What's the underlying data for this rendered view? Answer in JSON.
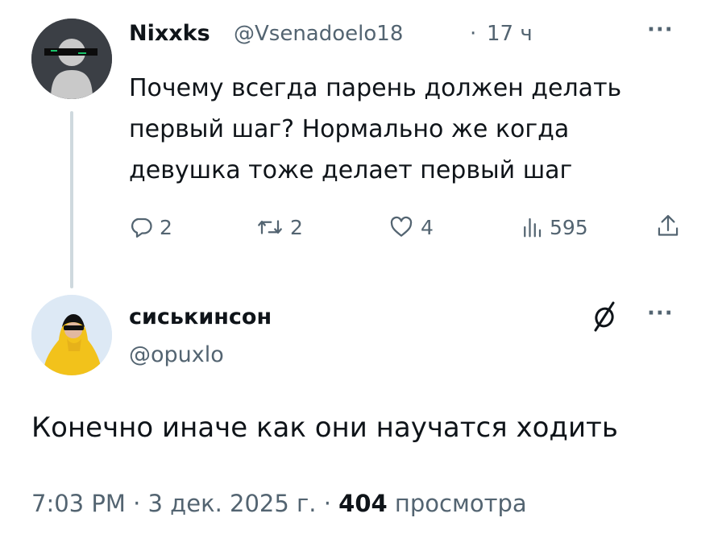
{
  "tweet1": {
    "display_name": "Nixxks",
    "handle": "@Vsenadoelo18",
    "separator": "·",
    "time": "17 ч",
    "more_label": "···",
    "text": "Почему всегда парень должен делать\nпервый шаг? Нормально же когда\nдевушка тоже делает первый шаг",
    "actions": {
      "reply_count": "2",
      "retweet_count": "2",
      "like_count": "4",
      "view_count": "595"
    }
  },
  "tweet2": {
    "display_name": "сиськинсон",
    "handle": "@opuxlo",
    "more_label": "···",
    "text": "Конечно иначе как они научатся ходить",
    "meta": {
      "time": "7:03 PM",
      "sep1": " · ",
      "date": "3 дек. 2025 г.",
      "sep2": " · ",
      "views_count": "404",
      "views_label": " просмотра"
    }
  },
  "icons": [
    "reply-icon",
    "retweet-icon",
    "like-icon",
    "views-icon",
    "share-icon",
    "badge-icon",
    "more-icon"
  ],
  "colors": {
    "text_primary": "#0f1419",
    "text_secondary": "#536471",
    "thread_line": "#cfd9de",
    "avatar2_hood": "#f2c21b"
  }
}
